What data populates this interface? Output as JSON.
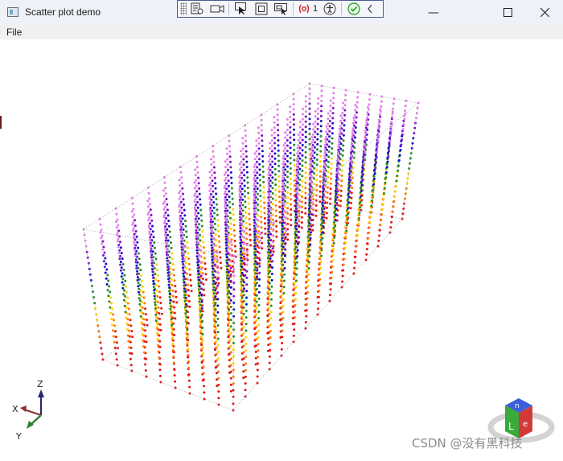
{
  "window": {
    "title": "Scatter plot demo",
    "controls": {
      "minimize": "—",
      "maximize": "☐",
      "close": "✕"
    }
  },
  "debug_toolbar": {
    "icons": [
      "live-visual-tree-icon",
      "record-icon",
      "select-element-icon",
      "display-layout-adorners-icon",
      "track-focus-icon",
      "binding-failures-icon",
      "accessibility-icon",
      "hot-reload-ok-icon",
      "collapse-chevron-icon"
    ],
    "binding_failures_count": "1",
    "colors": {
      "failure": "#d21f1f",
      "ok": "#1a9b1a"
    }
  },
  "menu": {
    "file_label": "File"
  },
  "plot": {
    "axis_labels": {
      "x": "X",
      "y": "Y",
      "z": "Z"
    },
    "axis_colors": {
      "x": "#8b3030",
      "y": "#2e7d2e",
      "z": "#28286e"
    },
    "color_gradient": [
      "#e01818",
      "#ff7a00",
      "#ffd000",
      "#2a8a2a",
      "#1010c8",
      "#7a10c8",
      "#e280e8"
    ],
    "cube_badge_letters": {
      "top": "n",
      "left": "L",
      "right": "e"
    },
    "cube_badge_colors": {
      "top": "#3a5fd8",
      "left": "#3aaa3a",
      "right": "#d23a3a"
    }
  },
  "watermark": "CSDN @没有黑科技"
}
